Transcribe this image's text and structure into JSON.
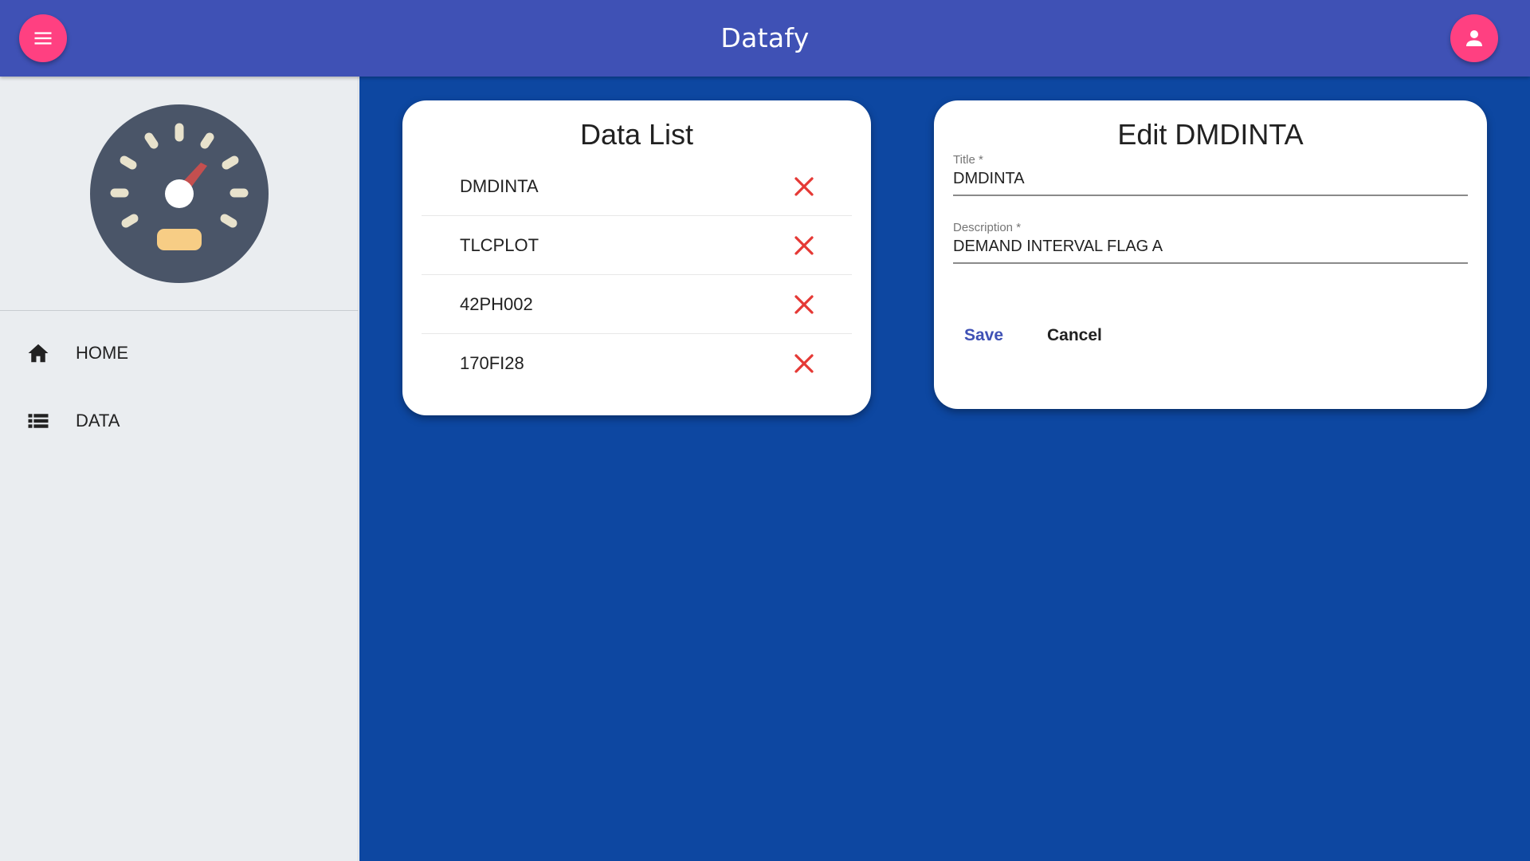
{
  "app": {
    "title": "Datafy"
  },
  "colors": {
    "appbar": "#3f51b5",
    "fab": "#ff4081",
    "main_bg": "#0d47a1",
    "sidebar_bg": "#eaedf0",
    "delete": "#e53935",
    "save": "#3f51b5"
  },
  "appbar": {
    "menu_icon": "menu-icon",
    "account_icon": "account-icon"
  },
  "sidebar": {
    "logo_icon": "speedometer-icon",
    "items": [
      {
        "label": "HOME",
        "icon": "home-icon"
      },
      {
        "label": "DATA",
        "icon": "list-icon"
      }
    ]
  },
  "data_list": {
    "title": "Data List",
    "delete_icon": "close-icon",
    "items": [
      {
        "label": "DMDINTA"
      },
      {
        "label": "TLCPLOT"
      },
      {
        "label": "42PH002"
      },
      {
        "label": "170FI28"
      }
    ]
  },
  "edit_form": {
    "title": "Edit DMDINTA",
    "title_field": {
      "label": "Title *",
      "value": "DMDINTA"
    },
    "description_field": {
      "label": "Description *",
      "value": "DEMAND INTERVAL FLAG A"
    },
    "save_label": "Save",
    "cancel_label": "Cancel"
  }
}
